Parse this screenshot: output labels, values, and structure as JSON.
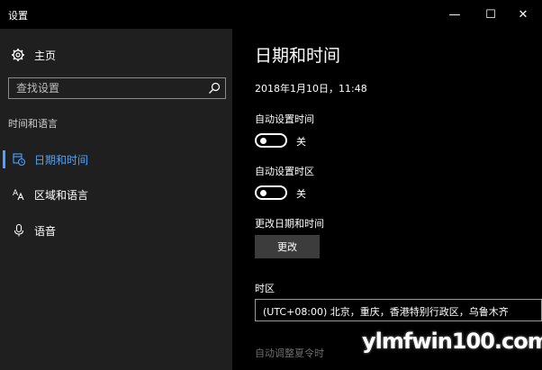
{
  "window": {
    "title": "设置",
    "controls": {
      "minimize": "—",
      "maximize": "☐",
      "close": "✕"
    }
  },
  "sidebar": {
    "home_label": "主页",
    "search_placeholder": "查找设置",
    "section_title": "时间和语言",
    "items": [
      {
        "label": "日期和时间",
        "icon": "calendar-clock-icon",
        "active": true
      },
      {
        "label": "区域和语言",
        "icon": "region-language-icon",
        "active": false
      },
      {
        "label": "语音",
        "icon": "microphone-icon",
        "active": false
      }
    ]
  },
  "main": {
    "title": "日期和时间",
    "datetime": "2018年1月10日，11:48",
    "auto_time": {
      "label": "自动设置时间",
      "state": "关"
    },
    "auto_timezone": {
      "label": "自动设置时区",
      "state": "关"
    },
    "change_section_label": "更改日期和时间",
    "change_button": "更改",
    "timezone_label": "时区",
    "timezone_value": "(UTC+08:00) 北京，重庆，香港特别行政区，乌鲁木齐",
    "dst_label": "自动调整夏令时"
  },
  "watermark": "ylmfwin100.com",
  "colors": {
    "accent": "#4aa3ff",
    "sidebar_bg": "#1f1f1f",
    "main_bg": "#000000"
  }
}
